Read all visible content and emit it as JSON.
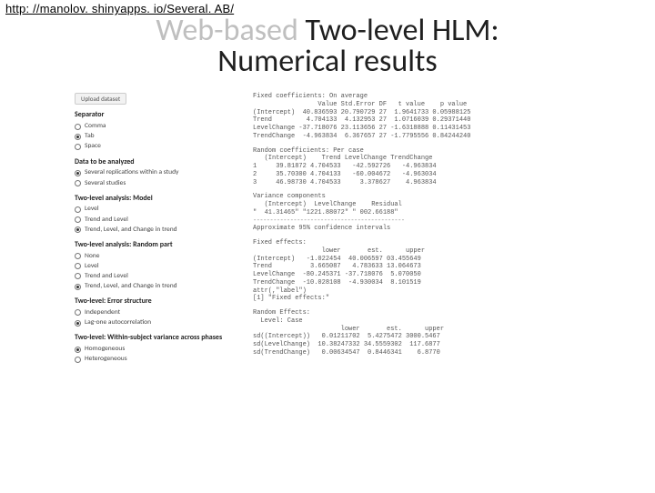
{
  "url": "http: //manolov. shinyapps. io/Several. AB/",
  "title": {
    "faint": "Web-based",
    "dark1": " Two-level HLM:",
    "line2": "Numerical results"
  },
  "sidebar": {
    "upload_label": "Upload dataset",
    "groups": [
      {
        "title": "Separator",
        "options": [
          {
            "label": "Comma",
            "selected": false
          },
          {
            "label": "Tab",
            "selected": true
          },
          {
            "label": "Space",
            "selected": false
          }
        ]
      },
      {
        "title": "Data to be analyzed",
        "options": [
          {
            "label": "Several replications within a study",
            "selected": true
          },
          {
            "label": "Several studies",
            "selected": false
          }
        ]
      },
      {
        "title": "Two-level analysis: Model",
        "options": [
          {
            "label": "Level",
            "selected": false
          },
          {
            "label": "Trend and Level",
            "selected": false
          },
          {
            "label": "Trend, Level, and Change in trend",
            "selected": true
          }
        ]
      },
      {
        "title": "Two-level analysis: Random part",
        "options": [
          {
            "label": "None",
            "selected": false
          },
          {
            "label": "Level",
            "selected": false
          },
          {
            "label": "Trend and Level",
            "selected": false
          },
          {
            "label": "Trend, Level, and Change in trend",
            "selected": true
          }
        ]
      },
      {
        "title": "Two-level: Error structure",
        "options": [
          {
            "label": "Independent",
            "selected": false
          },
          {
            "label": "Lag-one autocorrelation",
            "selected": true
          }
        ]
      },
      {
        "title": "Two-level: Within-subject variance across phases",
        "options": [
          {
            "label": "Homogeneous",
            "selected": true
          },
          {
            "label": "Heterogeneous",
            "selected": false
          }
        ]
      }
    ]
  },
  "output": {
    "fixed_header": "Fixed coefficients: On average",
    "fixed_cols": "                 Value Std.Error DF   t value    p value",
    "fixed_rows": [
      "(Intercept)  40.836593 20.790729 27  1.9641733 0.05988125",
      "Trend         4.704133  4.132953 27  1.0716039 0.29371440",
      "LevelChange -37.718076 23.113656 27 -1.6318888 0.11431453",
      "TrendChange  -4.963834  6.367657 27 -1.7795556 0.84244240"
    ],
    "random_header": "Random coefficients: Per case",
    "random_cols": "   (Intercept)    Trend LevelChange TrendChange",
    "random_rows": [
      "1     39.81872 4.704533   -42.592726   -4.963834",
      "2     35.70300 4.704133   -60.004672   -4.963034",
      "3     46.98730 4.704533     3.378627    4.963834"
    ],
    "varcomp_header": "Variance components",
    "varcomp_cols": "   (Intercept)  LevelChange    Residual",
    "varcomp_row": "\"  41.31465\" \"1221.88072\" \" 002.66188\"",
    "dash": "---------------------------------------------",
    "ci_header": "Approximate 95% confidence intervals",
    "fe_header": "Fixed effects:",
    "fe_cols": "                  lower       est.      upper",
    "fe_rows": [
      "(Intercept)   -1.022454  40.006597 03.455649",
      "Trend          3.665087   4.783633 13.064673",
      "LevelChange  -80.245371 -37.718076  5.070050",
      "TrendChange  -10.028108  -4.930034  8.101519"
    ],
    "attr_line": "attr(,\"label\")",
    "attr_line2": "[1] \"Fixed effects:\"",
    "re_header": "Random Effects:",
    "re_sub": "  Level: Case",
    "re_cols": "                       lower       est.      upper",
    "re_rows": [
      "sd((Intercept))   0.01211702  5.4275472 3000.5467",
      "sd(LevelChange)  10.38247332 34.5559302  117.6877",
      "sd(TrendChange)   0.00634547  0.8446341    6.8770"
    ]
  }
}
